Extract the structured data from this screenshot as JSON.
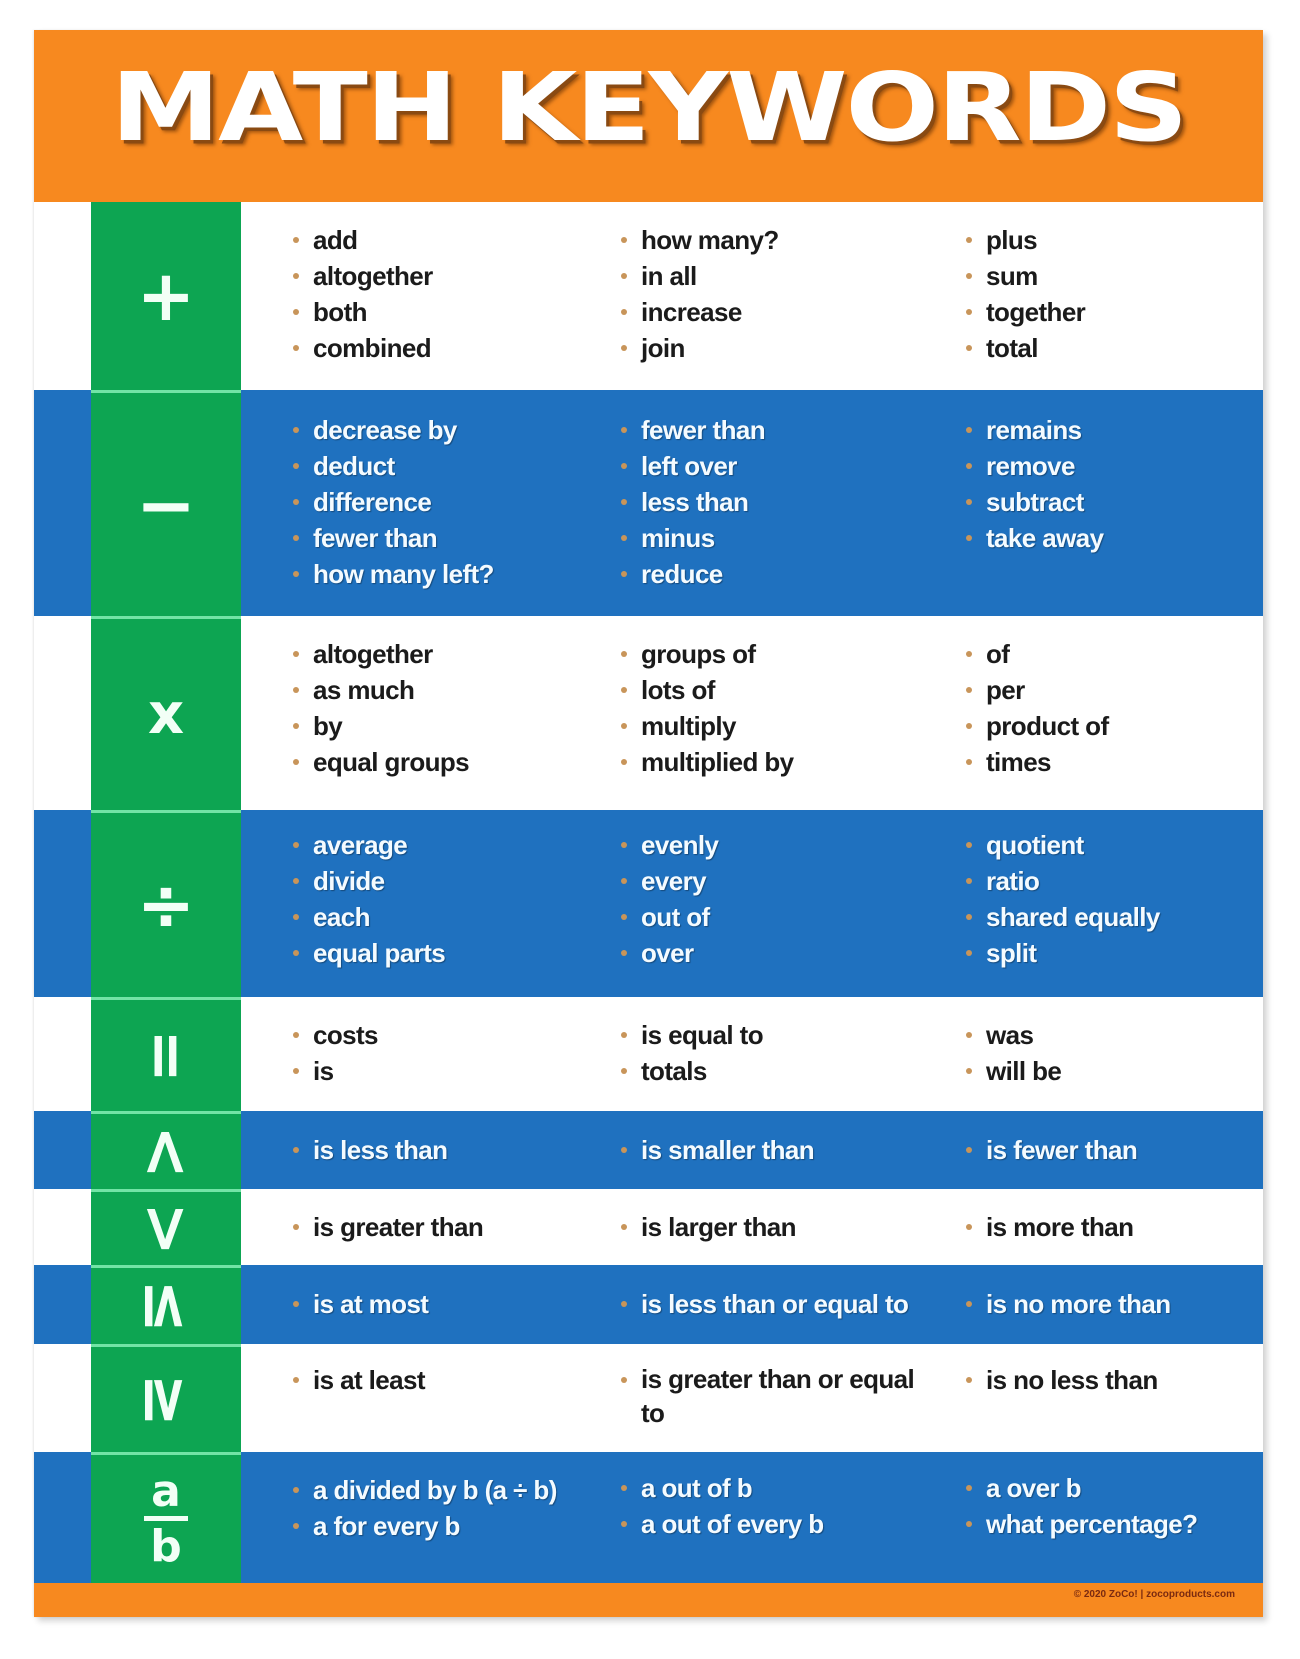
{
  "title": "MATH KEYWORDS",
  "colors": {
    "header_orange": "#f7891f",
    "symbol_green": "#0da552",
    "row_blue": "#1f71bf",
    "row_white": "#ffffff",
    "bullet": "#c8955a"
  },
  "rows": [
    {
      "operation": "addition",
      "symbol": "+",
      "columns": [
        [
          "add",
          "altogether",
          "both",
          "combined"
        ],
        [
          "how many?",
          "in all",
          "increase",
          "join"
        ],
        [
          "plus",
          "sum",
          "together",
          "total"
        ]
      ]
    },
    {
      "operation": "subtraction",
      "symbol": "−",
      "columns": [
        [
          "decrease by",
          "deduct",
          "difference",
          "fewer than",
          "how many left?"
        ],
        [
          "fewer than",
          "left over",
          "less than",
          "minus",
          "reduce"
        ],
        [
          "remains",
          "remove",
          "subtract",
          "take away"
        ]
      ]
    },
    {
      "operation": "multiplication",
      "symbol": "x",
      "columns": [
        [
          "altogether",
          "as much",
          "by",
          "equal groups"
        ],
        [
          "groups of",
          "lots of",
          "multiply",
          "multiplied by"
        ],
        [
          "of",
          "per",
          "product of",
          "times"
        ]
      ]
    },
    {
      "operation": "division",
      "symbol": "÷",
      "columns": [
        [
          "average",
          "divide",
          "each",
          "equal parts"
        ],
        [
          "evenly",
          "every",
          "out of",
          "over"
        ],
        [
          "quotient",
          "ratio",
          "shared equally",
          "split"
        ]
      ]
    },
    {
      "operation": "equals",
      "symbol": "=",
      "columns": [
        [
          "costs",
          "is"
        ],
        [
          "is equal to",
          "totals"
        ],
        [
          "was",
          "will be"
        ]
      ]
    },
    {
      "operation": "less-than",
      "symbol": "<",
      "columns": [
        [
          "is less than"
        ],
        [
          "is smaller than"
        ],
        [
          "is fewer than"
        ]
      ]
    },
    {
      "operation": "greater-than",
      "symbol": ">",
      "columns": [
        [
          "is greater than"
        ],
        [
          "is larger than"
        ],
        [
          "is more than"
        ]
      ]
    },
    {
      "operation": "less-than-or-equal",
      "symbol": "≤",
      "columns": [
        [
          "is at most"
        ],
        [
          "is less than or equal to"
        ],
        [
          "is no more than"
        ]
      ]
    },
    {
      "operation": "greater-than-or-equal",
      "symbol": "≥",
      "columns": [
        [
          "is at least"
        ],
        [
          "is greater than or equal to"
        ],
        [
          "is no less than"
        ]
      ]
    },
    {
      "operation": "fraction",
      "symbol_numerator": "a",
      "symbol_denominator": "b",
      "columns": [
        [
          "a divided by b (a ÷ b)",
          "a for every b"
        ],
        [
          "a out of b",
          "a out of every b"
        ],
        [
          "a over b",
          "what percentage?"
        ]
      ]
    }
  ],
  "footer": {
    "copyright": "© 2020 ZoCo! | zocoproducts.com"
  }
}
